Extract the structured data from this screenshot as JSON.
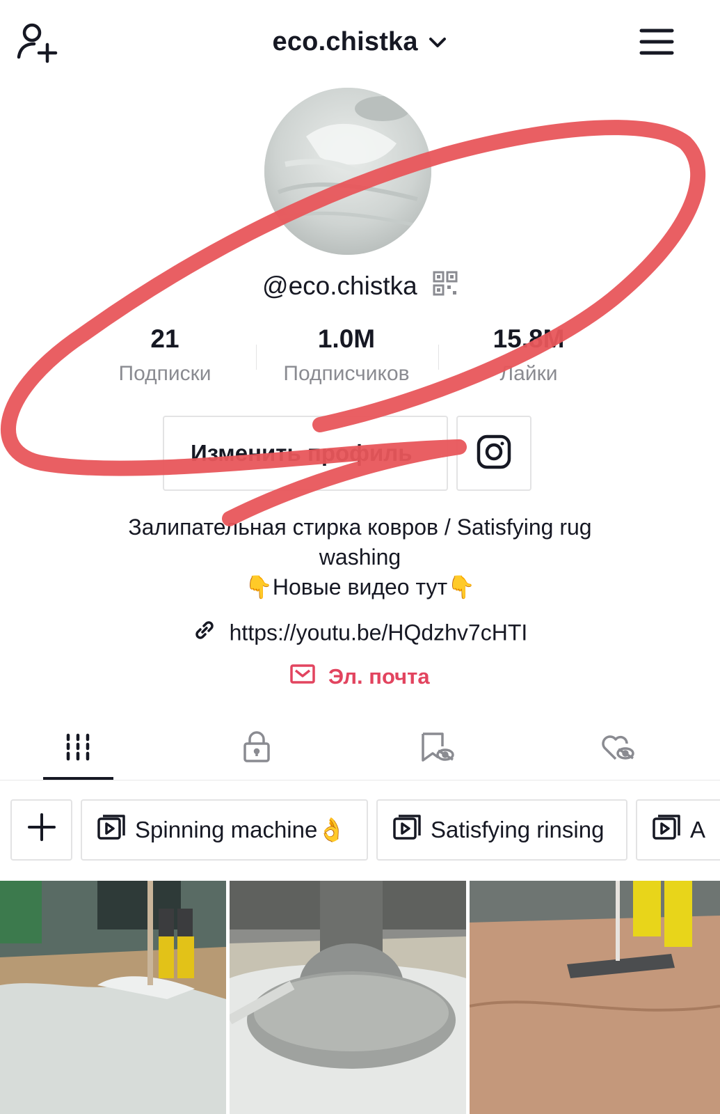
{
  "header": {
    "username": "eco.chistka",
    "icons": [
      "add-user-icon",
      "chevron-down-icon",
      "menu-icon"
    ]
  },
  "profile": {
    "handle": "@eco.chistka",
    "stats": [
      {
        "value": "21",
        "label": "Подписки"
      },
      {
        "value": "1.0M",
        "label": "Подписчиков"
      },
      {
        "value": "15.8M",
        "label": "Лайки"
      }
    ],
    "edit_button_label": "Изменить профиль",
    "bio_line1": "Залипательная стирка ковров / Satisfying rug",
    "bio_line2": "washing",
    "bio_line3_emoji_left": "👇",
    "bio_line3_text": "Новые видео тут",
    "bio_line3_emoji_right": "👇",
    "link": "https://youtu.be/HQdzhv7cHTI",
    "email_label": "Эл. почта"
  },
  "tabs": [
    {
      "name": "videos",
      "icon": "grid-icon",
      "active": true
    },
    {
      "name": "private",
      "icon": "lock-icon",
      "active": false
    },
    {
      "name": "favorites",
      "icon": "bookmark-hidden-icon",
      "active": false
    },
    {
      "name": "liked",
      "icon": "heart-hidden-icon",
      "active": false
    }
  ],
  "playlists": [
    {
      "label": "Spinning machine",
      "emoji": "👌"
    },
    {
      "label": "Satisfying rinsing",
      "emoji": ""
    },
    {
      "label": "A",
      "emoji": ""
    }
  ],
  "colors": {
    "accent": "#e2445f",
    "annotation_red": "#e8565b",
    "text_primary": "#161823",
    "text_secondary": "#8a8b91",
    "border": "#e3e3e4"
  }
}
